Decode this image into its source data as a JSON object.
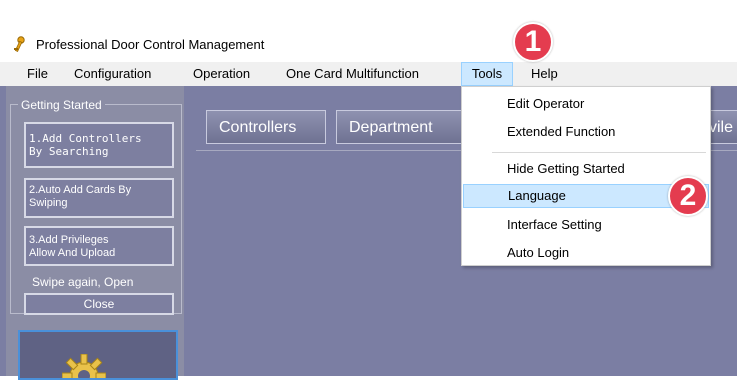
{
  "window": {
    "title": "Professional Door Control Management"
  },
  "menubar": {
    "items": [
      {
        "label": "File"
      },
      {
        "label": "Configuration"
      },
      {
        "label": "Operation"
      },
      {
        "label": "One Card Multifunction"
      },
      {
        "label": "Tools"
      },
      {
        "label": "Help"
      }
    ],
    "active": "Tools"
  },
  "sidebar": {
    "group_title": "Getting Started",
    "steps": [
      {
        "line1": "1.Add Controllers",
        "line2": "By Searching"
      },
      {
        "line1": "2.Auto Add Cards By",
        "line2": "Swiping"
      },
      {
        "line1": "3.Add Privileges",
        "line2": "Allow And Upload"
      }
    ],
    "swipe_text": "Swipe again, Open",
    "close_label": "Close",
    "tile_icon": "gear-icon"
  },
  "tabs": [
    {
      "label": "Controllers"
    },
    {
      "label": "Department"
    },
    {
      "label": "vile"
    }
  ],
  "tools_menu": {
    "items": [
      {
        "label": "Edit Operator"
      },
      {
        "label": "Extended Function"
      },
      {
        "label": "Hide Getting Started"
      },
      {
        "label": "Language"
      },
      {
        "label": "Interface Setting"
      },
      {
        "label": "Auto Login"
      }
    ],
    "highlighted": "Language"
  },
  "callouts": [
    {
      "label": "1"
    },
    {
      "label": "2"
    }
  ],
  "colors": {
    "app_background": "#7b7ea3",
    "menu_highlight": "#cce8ff",
    "callout": "#e43c4f"
  }
}
